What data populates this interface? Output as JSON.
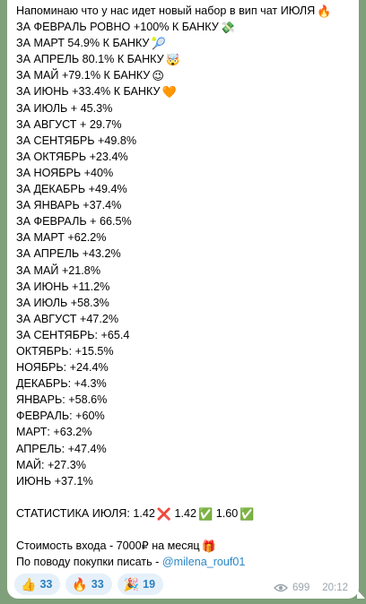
{
  "message": {
    "lines": [
      {
        "text": "Напоминаю что у нас идет новый набор в вип чат ИЮЛЯ",
        "emoji": "🔥"
      },
      {
        "text": "ЗА ФЕВРАЛЬ РОВНО +100% К БАНКУ",
        "emoji": "💸"
      },
      {
        "text": "ЗА МАРТ 54.9% К БАНКУ",
        "emoji": "🎾"
      },
      {
        "text": "ЗА АПРЕЛЬ 80.1% К БАНКУ",
        "emoji": "🤯"
      },
      {
        "text": "ЗА МАЙ +79.1% К БАНКУ",
        "emoji": "😉"
      },
      {
        "text": "ЗА ИЮНЬ +33.4% К БАНКУ",
        "emoji": "🧡"
      },
      {
        "text": "ЗА ИЮЛЬ + 45.3%",
        "emoji": ""
      },
      {
        "text": "ЗА АВГУСТ + 29.7%",
        "emoji": ""
      },
      {
        "text": "ЗА СЕНТЯБРЬ +49.8%",
        "emoji": ""
      },
      {
        "text": "ЗА ОКТЯБРЬ +23.4%",
        "emoji": ""
      },
      {
        "text": "ЗА НОЯБРЬ +40%",
        "emoji": ""
      },
      {
        "text": "ЗА ДЕКАБРЬ +49.4%",
        "emoji": ""
      },
      {
        "text": "ЗА ЯНВАРЬ +37.4%",
        "emoji": ""
      },
      {
        "text": "ЗА ФЕВРАЛЬ + 66.5%",
        "emoji": ""
      },
      {
        "text": "ЗА МАРТ +62.2%",
        "emoji": ""
      },
      {
        "text": "ЗА АПРЕЛЬ +43.2%",
        "emoji": ""
      },
      {
        "text": "ЗА МАЙ +21.8%",
        "emoji": ""
      },
      {
        "text": "ЗА ИЮНЬ +11.2%",
        "emoji": ""
      },
      {
        "text": "ЗА ИЮЛЬ +58.3%",
        "emoji": ""
      },
      {
        "text": "ЗА АВГУСТ +47.2%",
        "emoji": ""
      },
      {
        "text": "ЗА СЕНТЯБРЬ: +65.4",
        "emoji": ""
      },
      {
        "text": "ОКТЯБРЬ: +15.5%",
        "emoji": ""
      },
      {
        "text": "НОЯБРЬ: +24.4%",
        "emoji": ""
      },
      {
        "text": "ДЕКАБРЬ: +4.3%",
        "emoji": ""
      },
      {
        "text": "ЯНВАРЬ: +58.6%",
        "emoji": ""
      },
      {
        "text": "ФЕВРАЛЬ: +60%",
        "emoji": ""
      },
      {
        "text": "МАРТ: +63.2%",
        "emoji": ""
      },
      {
        "text": "АПРЕЛЬ: +47.4%",
        "emoji": ""
      },
      {
        "text": "МАЙ: +27.3%",
        "emoji": ""
      },
      {
        "text": "ИЮНЬ +37.1%",
        "emoji": ""
      }
    ],
    "stats": {
      "label": "СТАТИСТИКА ИЮЛЯ:",
      "v1": "1.42",
      "e1": "❌",
      "v2": "1.42",
      "e2": "✅",
      "v3": "1.60",
      "e3": "✅"
    },
    "price_text": "Стоимость входа - 7000₽ на месяц",
    "price_emoji": "🎁",
    "contact_prefix": "По поводу покупки писать - ",
    "contact_link": "@milena_rouf01"
  },
  "reactions": [
    {
      "icon": "👍",
      "icon_name": "thumbs-up-icon",
      "count": "33"
    },
    {
      "icon": "🔥",
      "icon_name": "fire-icon",
      "count": "33"
    },
    {
      "icon": "🎉",
      "icon_name": "party-popper-icon",
      "count": "19"
    }
  ],
  "meta": {
    "views": "699",
    "time": "20:12"
  },
  "colors": {
    "background": "#7fa07a",
    "bubble": "#ffffff",
    "link": "#2a86c8",
    "reaction_bg": "#e5f0fa",
    "reaction_text": "#2a7fc0",
    "meta_text": "#9aa4ad"
  }
}
